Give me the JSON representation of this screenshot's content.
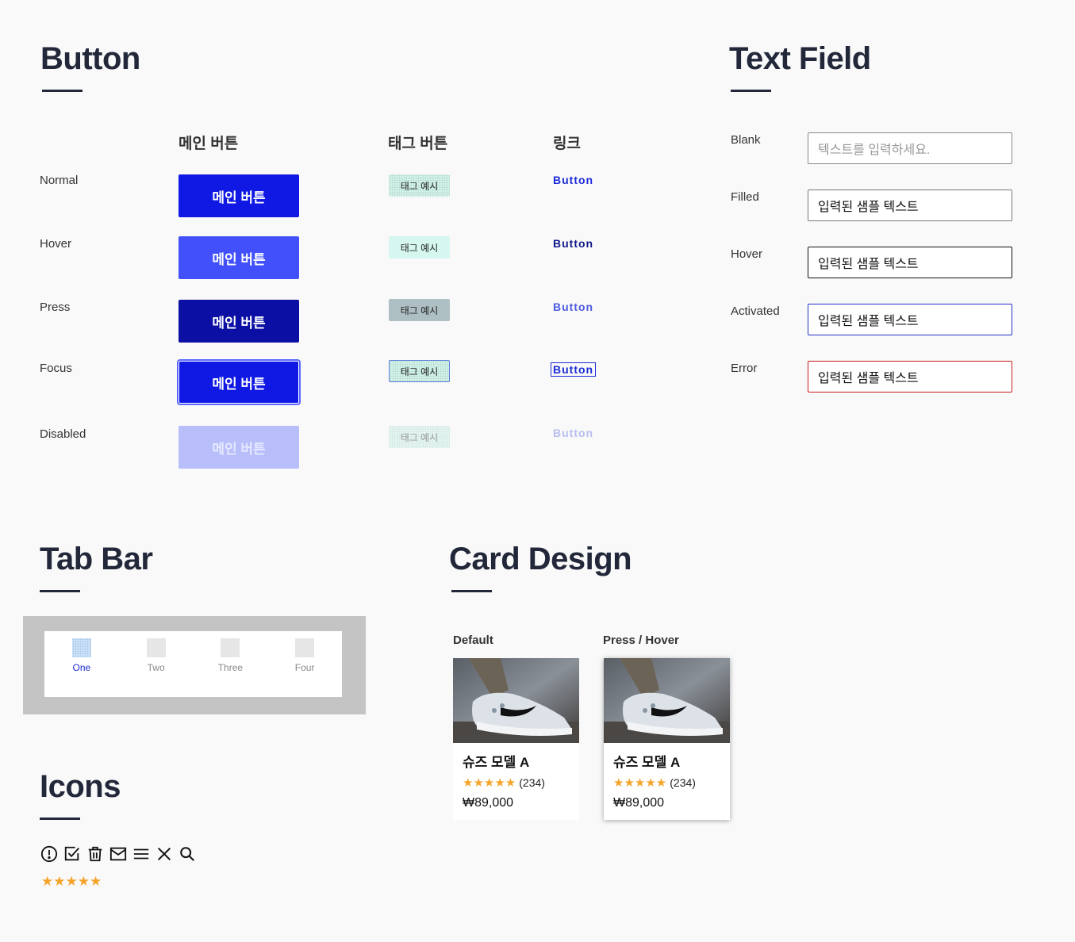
{
  "button_section": {
    "title": "Button",
    "columns": [
      "메인 버튼",
      "태그 버튼",
      "링크"
    ],
    "rows": [
      "Normal",
      "Hover",
      "Press",
      "Focus",
      "Disabled"
    ],
    "main_label": "메인 버튼",
    "tag_label": "태그 예시",
    "link_label": "Button"
  },
  "text_field_section": {
    "title": "Text Field",
    "labels": [
      "Blank",
      "Filled",
      "Hover",
      "Activated",
      "Error"
    ],
    "placeholder": "텍스트를 입력하세요.",
    "value": "입력된 샘플 텍스트"
  },
  "tab_bar_section": {
    "title": "Tab Bar",
    "tabs": [
      "One",
      "Two",
      "Three",
      "Four"
    ],
    "active_tab": "One"
  },
  "icons_section": {
    "title": "Icons",
    "icons": [
      "alert-circle-icon",
      "checkbox-icon",
      "trash-icon",
      "mail-icon",
      "menu-icon",
      "close-icon",
      "search-icon"
    ],
    "stars": "★★★★★",
    "star_color": "#f4a42a"
  },
  "card_section": {
    "title": "Card Design",
    "states": [
      "Default",
      "Press / Hover"
    ],
    "card": {
      "name": "슈즈 모델 A",
      "stars": "★★★★★",
      "reviews": "(234)",
      "price": "₩89,000"
    }
  },
  "colors": {
    "primary": "#1019e3",
    "primary_hover": "#4150fa",
    "primary_press": "#0b0fa3",
    "primary_disabled": "#b7befa",
    "error": "#c81a1a",
    "title": "#22283a"
  }
}
